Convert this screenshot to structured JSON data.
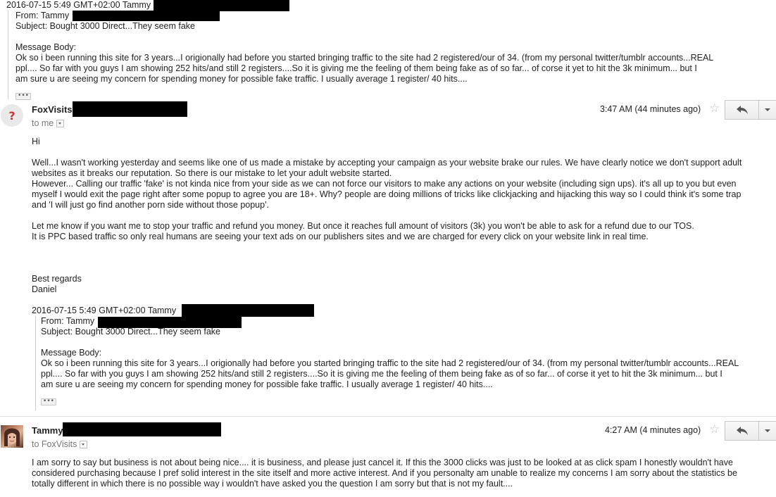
{
  "top_quote": {
    "header_line": "2016-07-15 5:49 GMT+02:00 Tammy",
    "from_line": "From: Tammy",
    "subject_line": "Subject: Bought 3000 Direct...They seem fake",
    "body_label": "Message Body:",
    "body_lines": [
      "Ok so i been running this site for 3 years...I origionally had before you started bringing traffic to the site had 2 registered/our of 34. (from my personal twitter/tumblr accounts...REAL",
      "ppl.... So far with you guys I am showing 252 hits/and still 2 registers....So it is giving me the feeling of them being fake as of so far... of corse it yet to hit the 3k minimum... but I",
      "am sure u are seeing my concern for spending money for possible fake traffic. I usually average 1 register/ 40 hits...."
    ],
    "ellipsis": "•••"
  },
  "message_1": {
    "avatar_glyph": "?",
    "sender": "FoxVisits",
    "to_line": "to me",
    "time": "3:47 AM (44 minutes ago)",
    "star": "☆",
    "reply_icon": "reply-arrow",
    "body_lines": [
      "Hi",
      "",
      "Well...I wasn't working yesterday and seems like one of us made a mistake by accepting your campaign as your website brake our rules. We have clearly notice we don't support adult",
      "websites as it breaks our reputation. So there is our mistake to let your adult website started.",
      "However... Calling our traffic 'fake' is not kinda nice from your side as we can not force our visitors to make any actions on your website (including sign ups). it's all up to you but even",
      "myself I would exit the page right after some popup to agree you are 18+. Why? people are doing millions of tricks like clickjacking and hijacking this way so I could think it's some trap",
      "and 'I will just go find another porn side without those popup'.",
      "",
      "Let me know if you want me to stop your traffic and refund you money. But once it reaches full amount of visitors (3k) you won't be able to ask for a refund due to our TOS.",
      "It is PPC based traffic so only real humans are seeing your text ads on our publishers sites and we are charged for every click on your website link in real time.",
      "",
      "",
      "",
      "Best regards",
      "Daniel"
    ],
    "quote": {
      "header_line": "2016-07-15 5:49 GMT+02:00 Tammy",
      "from_line": "From: Tammy",
      "subject_line": "Subject: Bought 3000 Direct...They seem fake",
      "body_label": "Message Body:",
      "body_lines": [
        "Ok so i been running this site for 3 years...I origionally had before you started bringing traffic to the site had 2 registered/our of 34. (from my personal twitter/tumblr accounts...REAL",
        "ppl.... So far with you guys I am showing 252 hits/and still 2 registers....So it is giving me the feeling of them being fake as of so far... of corse it yet to hit the 3k minimum... but I",
        "am sure u are seeing my concern for spending money for possible fake traffic. I usually average 1 register/ 40 hits...."
      ],
      "ellipsis": "•••"
    }
  },
  "message_2": {
    "sender": "Tammy",
    "to_line": "to FoxVisits",
    "time": "4:27 AM (4 minutes ago)",
    "star": "☆",
    "reply_icon": "reply-arrow",
    "body_lines": [
      "I am sorry to say but business is not about being nice.... it is business, and please just cancel it. If this the 3000 clicks was just to be looked at as click spam I honestly wouldn't have",
      "considered purchasing because I pref solid interest in the site itself and more active interest. And if you personalty am unable to realize my concerns I am sorry about the statistics be",
      "totally different in which there is no possible way i wouldn't have asked you the question I am sorry but that is not my fault...."
    ]
  }
}
